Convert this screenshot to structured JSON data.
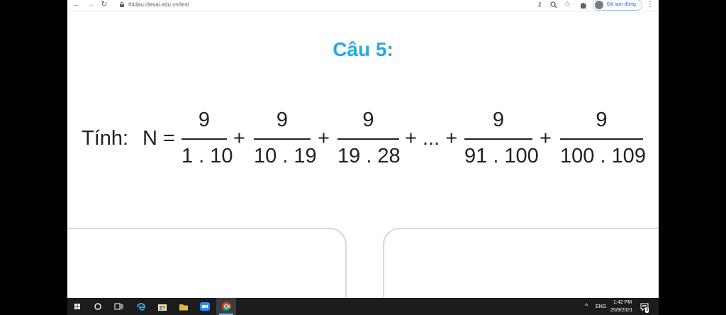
{
  "browser": {
    "url": "thidau.clevai.edu.vn/test",
    "profile_label": "Đã tạm dừng"
  },
  "page": {
    "title": "Câu 5:",
    "formula": {
      "label": "Tính:",
      "lhs": "N =",
      "fractions": [
        {
          "num": "9",
          "den": "1 . 10"
        },
        {
          "num": "9",
          "den": "10 . 19"
        },
        {
          "num": "9",
          "den": "19 . 28"
        },
        {
          "num": "9",
          "den": "91 . 100"
        },
        {
          "num": "9",
          "den": "100 . 109"
        }
      ],
      "operators": [
        "+",
        "+",
        "+ ... +",
        "+"
      ]
    }
  },
  "taskbar": {
    "language": "ENG",
    "time": "1:42 PM",
    "date": "25/9/2021",
    "notification_count": "3"
  },
  "colors": {
    "title": "#29a8e0",
    "profile": "#1a73e8",
    "taskbar": "#1c1c1c"
  }
}
